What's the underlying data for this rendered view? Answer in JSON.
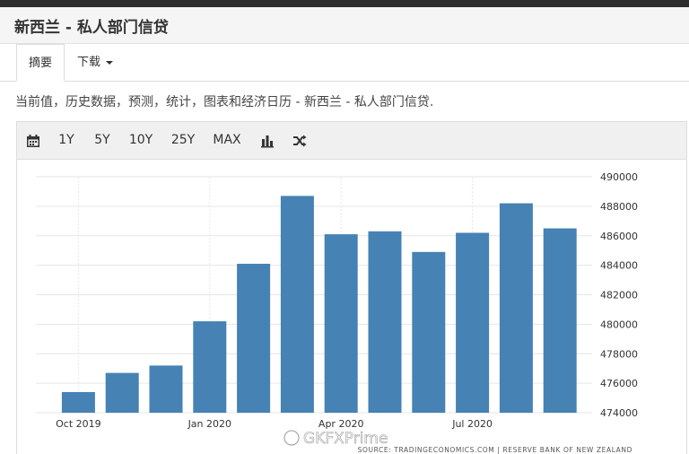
{
  "header": {
    "title": "新西兰 - 私人部门信贷"
  },
  "tabs": [
    {
      "label": "摘要"
    },
    {
      "label": "下载"
    }
  ],
  "description": "当前值，历史数据，预测，统计，图表和经济日历 - 新西兰 - 私人部门信贷.",
  "toolbar": {
    "calendar_icon": "calendar-icon",
    "ranges": [
      "1Y",
      "5Y",
      "10Y",
      "25Y",
      "MAX"
    ],
    "chart_type_icon": "bar-chart-icon",
    "compare_icon": "shuffle-icon"
  },
  "colors": {
    "bar": "#4682b4",
    "grid": "#e6e6e6",
    "header_bg": "#f5f5f5",
    "toolbar_bg": "#f0f0f0"
  },
  "chart_data": {
    "type": "bar",
    "title": "",
    "xlabel": "",
    "ylabel": "",
    "categories": [
      "2019-10",
      "2019-11",
      "2019-12",
      "2020-01",
      "2020-02",
      "2020-03",
      "2020-04",
      "2020-05",
      "2020-06",
      "2020-07",
      "2020-08",
      "2020-09"
    ],
    "values": [
      475400,
      476700,
      477200,
      480200,
      484100,
      488700,
      486100,
      486300,
      484900,
      486200,
      488200,
      486500
    ],
    "ylim": [
      474000,
      490000
    ],
    "yticks": [
      "474000",
      "476000",
      "478000",
      "480000",
      "482000",
      "484000",
      "486000",
      "488000",
      "490000"
    ],
    "xtick_labels": [
      {
        "category": "2019-10",
        "label": "Oct 2019"
      },
      {
        "category": "2020-01",
        "label": "Jan 2020"
      },
      {
        "category": "2020-04",
        "label": "Apr 2020"
      },
      {
        "category": "2020-07",
        "label": "Jul 2020"
      }
    ],
    "grid": true,
    "source": "SOURCE: TRADINGECONOMICS.COM  |  RESERVE BANK OF NEW ZEALAND"
  },
  "watermark": "GKFXPrime"
}
